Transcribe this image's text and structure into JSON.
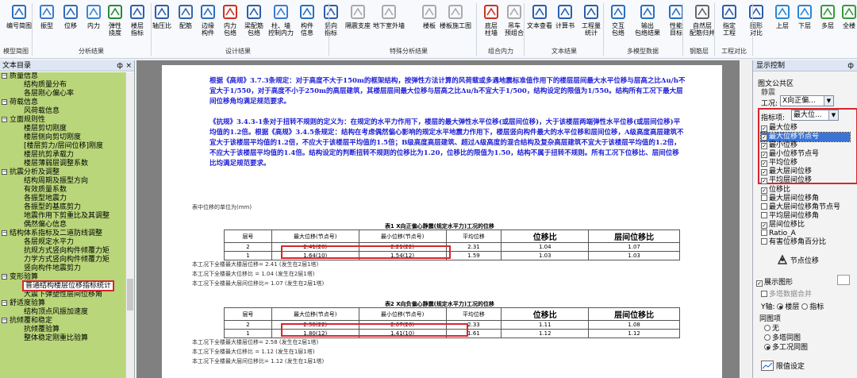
{
  "ribbon": {
    "buttons": [
      {
        "label": "编号简图",
        "icon": "building-icon"
      },
      {
        "label": "振型",
        "icon": "mode-shape-icon"
      },
      {
        "label": "位移",
        "icon": "displacement-icon"
      },
      {
        "label": "内力",
        "icon": "internal-force-icon"
      },
      {
        "label": "弹性\n挠度",
        "icon": "deflection-icon"
      },
      {
        "label": "楼层\n指标",
        "icon": "floor-index-icon"
      },
      {
        "label": "轴压比",
        "icon": "axial-ratio-icon"
      },
      {
        "label": "配筋",
        "icon": "rebar-icon"
      },
      {
        "label": "边缘\n构件",
        "icon": "edge-member-icon"
      },
      {
        "label": "内力\n包络",
        "icon": "envelope-icon"
      },
      {
        "label": "梁配筋\n包络",
        "icon": "beam-rebar-icon"
      },
      {
        "label": "柱、墙\n控制内力",
        "icon": "column-wall-icon"
      },
      {
        "label": "构件\n信息",
        "icon": "member-info-icon"
      },
      {
        "label": "竖向\n指标",
        "icon": "vertical-index-icon"
      },
      {
        "label": "隔震支座",
        "icon": "isolation-icon"
      },
      {
        "label": "地下室外墙",
        "icon": "basement-wall-icon"
      },
      {
        "label": "楼板",
        "icon": "slab-icon"
      },
      {
        "label": "楼板施工图",
        "icon": "slab-drawing-icon"
      },
      {
        "label": "底层\n柱墙",
        "icon": "base-column-icon"
      },
      {
        "label": "吊车\n预组合",
        "icon": "crane-icon"
      },
      {
        "label": "文本查看",
        "icon": "text-view-icon"
      },
      {
        "label": "计算书",
        "icon": "word-doc-icon"
      },
      {
        "label": "工程量\n统计",
        "icon": "quantity-icon"
      },
      {
        "label": "交互\n包络",
        "icon": "user-icon"
      },
      {
        "label": "输出\n包络结果",
        "icon": "output-icon"
      },
      {
        "label": "性能\n目标",
        "icon": "person-icon"
      },
      {
        "label": "自然层\n配筋归并",
        "icon": "layers-icon"
      },
      {
        "label": "指定\n工程",
        "icon": "designate-icon"
      },
      {
        "label": "图形\n对比",
        "icon": "compare-icon"
      },
      {
        "label": "上层",
        "icon": "up-arrow-icon"
      },
      {
        "label": "下层",
        "icon": "down-arrow-icon"
      },
      {
        "label": "多层",
        "icon": "multi-layer-icon"
      },
      {
        "label": "全楼",
        "icon": "all-floors-icon"
      }
    ],
    "groups": [
      "模型简图",
      "分析结果",
      "设计结果",
      "特殊分析结果",
      "组合内力",
      "文本结果",
      "多模型数据",
      "钢筋层",
      "工程对比"
    ]
  },
  "left_panel": {
    "title": "文本目录",
    "pin": "ф",
    "close": "×",
    "tree": [
      {
        "level": 0,
        "label": "质量信息",
        "expanded": true
      },
      {
        "level": 1,
        "label": "结构质量分布"
      },
      {
        "level": 1,
        "label": "各层刚心偏心率"
      },
      {
        "level": 0,
        "label": "荷载信息",
        "expanded": true
      },
      {
        "level": 1,
        "label": "风荷载信息"
      },
      {
        "level": 0,
        "label": "立面规则性",
        "expanded": true
      },
      {
        "level": 1,
        "label": "楼层剪切刚度"
      },
      {
        "level": 1,
        "label": "楼层侧向剪切刚度"
      },
      {
        "level": 1,
        "label": "[楼层剪力/层间位移]刚度"
      },
      {
        "level": 1,
        "label": "楼层抗剪承载力"
      },
      {
        "level": 1,
        "label": "楼层薄弱层调整系数"
      },
      {
        "level": 0,
        "label": "抗震分析及调整",
        "expanded": true
      },
      {
        "level": 1,
        "label": "结构周期及振型方向"
      },
      {
        "level": 1,
        "label": "有效质量系数"
      },
      {
        "level": 1,
        "label": "各振型地震力"
      },
      {
        "level": 1,
        "label": "各振型的基底剪力"
      },
      {
        "level": 1,
        "label": "地震作用下剪重比及其调整"
      },
      {
        "level": 1,
        "label": "偶然偏心信息"
      },
      {
        "level": 0,
        "label": "结构体系指标及二道防线调整",
        "expanded": true
      },
      {
        "level": 1,
        "label": "各层规定水平力"
      },
      {
        "level": 1,
        "label": "抗规方式竖向构件倾覆力矩"
      },
      {
        "level": 1,
        "label": "力学方式竖向构件倾覆力矩"
      },
      {
        "level": 1,
        "label": "竖向构件地震剪力"
      },
      {
        "level": 0,
        "label": "变形验算",
        "expanded": true
      },
      {
        "level": 1,
        "label": "普通结构楼层位移指标统计",
        "selected": true
      },
      {
        "level": 1,
        "label": "大震下弹塑性层间位移角"
      },
      {
        "level": 0,
        "label": "舒适度验算",
        "expanded": true
      },
      {
        "level": 1,
        "label": "结构顶点风振加速度"
      },
      {
        "level": 0,
        "label": "抗倾覆和稳定",
        "expanded": true
      },
      {
        "level": 1,
        "label": "抗倾覆验算"
      },
      {
        "level": 1,
        "label": "整体稳定刚重比验算"
      }
    ]
  },
  "document": {
    "para1": "根据《高规》3.7.3条规定：对于高度不大于150m的框架结构，按弹性方法计算的风荷载或多遇地震标准值作用下的楼层层间最大水平位移与层高之比Δu/h不宜大于1/550，对于高度不小于250m的高层建筑，其楼层层间最大位移与层高之比Δu/h不宜大于1/500，结构设定的限值为1/550。结构所有工况下最大层间位移角均满足规范要求。",
    "para2": "《抗规》3.4.3-1条对于扭转不规则的定义为：在规定的水平力作用下，楼层的最大弹性水平位移(或层间位移)，大于该楼层两端弹性水平位移(或层间位移)平均值的1.2倍。根据《高规》3.4.5条规定：结构在考虑偶然偏心影响的规定水平地震力作用下，楼层竖向构件最大的水平位移和层间位移，A级高度高层建筑不宜大于该楼层平均值的1.2倍，不应大于该楼层平均值的1.5倍；B级高度高层建筑、超过A级高度的混合结构及复杂高层建筑不宜大于该楼层平均值的1.2倍，不应大于该楼层平均值的1.4倍。结构设定的判断扭转不规则的位移比为1.20，位移比的限值为1.50，结构不属于扭转不规则。所有工况下位移比、层间位移比均满足规范要求。",
    "unit_note": "表中位移的单位为(mm)",
    "table1_caption": "表1 X向正偏心静震(规定水平力)工况的位移",
    "table2_caption": "表2 X向负偏心静震(规定水平力)工况的位移",
    "headers": [
      "层号",
      "最大位移(节点号)",
      "最小位移(节点号)",
      "平均位移",
      "位移比",
      "层间位移比"
    ],
    "table1_rows": [
      [
        "2",
        "2.41(20)",
        "2.21(22)",
        "2.31",
        "1.04",
        "1.07"
      ],
      [
        "1",
        "1.64(10)",
        "1.54(12)",
        "1.59",
        "1.03",
        "1.03"
      ]
    ],
    "table2_rows": [
      [
        "2",
        "2.58(22)",
        "2.07(20)",
        "2.33",
        "1.11",
        "1.08"
      ],
      [
        "1",
        "1.80(12)",
        "1.41(10)",
        "1.61",
        "1.12",
        "1.12"
      ]
    ],
    "table1_notes": [
      "本工况下全楼最大楼层位移= 2.41 (发生在2层1塔)",
      "本工况下全楼最大位移比 = 1.04 (发生在2层1塔)",
      "本工况下全楼最大层间位移比= 1.07 (发生在2层1塔)"
    ],
    "table2_notes": [
      "本工况下全楼最大楼层位移= 2.58 (发生在2层1塔)",
      "本工况下全楼最大位移比 = 1.12 (发生在1层1塔)",
      "本工况下全楼最大层间位移比= 1.12 (发生在1层1塔)"
    ]
  },
  "right_panel": {
    "title": "显示控制",
    "pin": "ф",
    "legend_section": "图文公共区",
    "static_label": "静震",
    "case_label": "工况:",
    "case_value": "X向正偏...",
    "index_label": "指标项:",
    "index_value": "最大位...",
    "dropdown_options": [
      "最大位移",
      "最大位移节点号",
      "最小位移",
      "最小位移节点号",
      "平均位移",
      "最大层间位移",
      "平均层间位移"
    ],
    "list_items": [
      "位移比",
      "最大层间位移角",
      "最大层间位移角节点号",
      "平均层间位移角",
      "层间位移比",
      "Ratio_A",
      "有害位移角百分比"
    ],
    "node_disp_label": "节点位移",
    "show_graph_label": "展示图形",
    "multi_merge_label": "多塔数据合并",
    "y_axis_label": "Y轴:",
    "y_opt1": "楼层",
    "y_opt2": "指标",
    "compare_label": "同图项",
    "compare_none": "无",
    "compare_multi_tower": "多塔同图",
    "compare_multi_case": "多工况同图",
    "limit_label": "限值设定"
  }
}
